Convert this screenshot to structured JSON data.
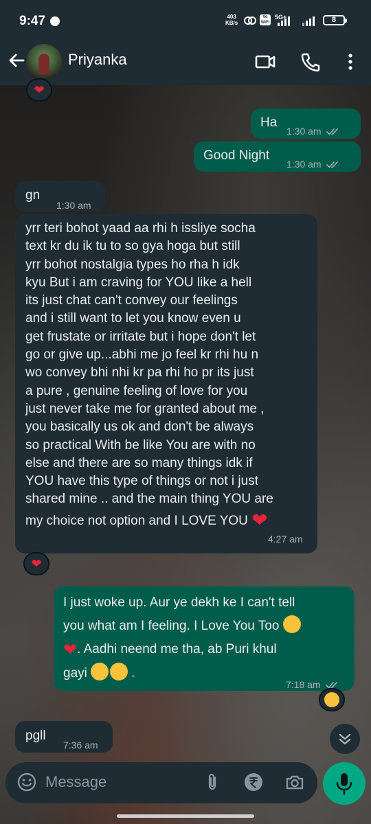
{
  "status_bar": {
    "time": "9:47",
    "net_speed_value": "403",
    "net_speed_unit": "KB/s",
    "volte": "Vo WiFi",
    "network": "5G+",
    "battery": "8"
  },
  "header": {
    "contact_name": "Priyanka"
  },
  "messages": [
    {
      "direction": "out",
      "text": "Ha",
      "time": "1:30 am",
      "status": "read"
    },
    {
      "direction": "out",
      "text": "Good Night",
      "time": "1:30 am",
      "status": "read"
    },
    {
      "direction": "in",
      "text": "gn",
      "time": "1:30 am"
    },
    {
      "direction": "in",
      "lines": [
        "yrr teri bohot yaad aa rhi h issliye socha",
        "text kr du ik tu to so gya hoga but still",
        "yrr bohot nostalgia types ho rha h idk",
        "kyu But i am craving for YOU like a hell",
        "its just chat can't convey our feelings",
        "and i still want to let you know even u",
        "get frustate or irritate but i hope don't let",
        "go or give up...abhi me jo feel kr rhi hu n",
        "wo convey bhi nhi kr pa rhi ho pr its just",
        "a pure , genuine feeling of love for you",
        "just never take me for granted about me ,",
        "you basically us ok and don't be always",
        "so practical With be like You are with no",
        "else and there are so many things idk if",
        "YOU have this type of things or not i just",
        "shared mine .. and the main thing YOU are",
        "my choice not option and I LOVE YOU"
      ],
      "time": "4:27 am",
      "reaction": "heart"
    },
    {
      "direction": "out",
      "lines": [
        "I just woke up. Aur ye dekh ke I can't tell",
        "you what am I feeling. I Love You Too",
        ". Aadhi neend me tha, ab Puri khul",
        "gayi"
      ],
      "trailing": ".",
      "time": "7:18 am",
      "status": "read",
      "reaction": "joy"
    },
    {
      "direction": "in",
      "text": "pgll",
      "time": "7:36 am"
    }
  ],
  "input": {
    "placeholder": "Message"
  },
  "icons": {
    "back": "arrow-back-icon",
    "video": "video-call-icon",
    "call": "voice-call-icon",
    "menu": "more-vert-icon",
    "emoji": "emoji-icon",
    "attach": "attach-icon",
    "payment": "rupee-icon",
    "camera": "camera-icon",
    "mic": "mic-icon",
    "scroll": "scroll-down-icon"
  },
  "colors": {
    "header_bg": "#1f2c34",
    "incoming_bubble": "#1f2c34",
    "outgoing_bubble": "#005c4b",
    "accent": "#00a884",
    "read_ticks": "#a8b3b8"
  }
}
